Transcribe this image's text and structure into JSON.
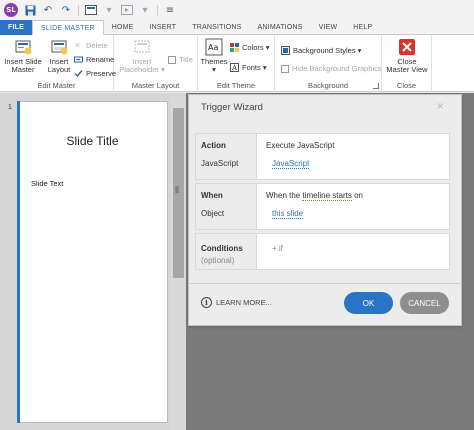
{
  "app": {
    "logo_text": "SL"
  },
  "quick_access": {
    "icons": [
      "save-icon",
      "undo-icon",
      "redo-icon",
      "slide-icon",
      "dropdown-icon",
      "preview-icon",
      "publish-icon",
      "customize-icon"
    ]
  },
  "tabs": [
    {
      "label": "FILE"
    },
    {
      "label": "SLIDE MASTER"
    },
    {
      "label": "HOME"
    },
    {
      "label": "INSERT"
    },
    {
      "label": "TRANSITIONS"
    },
    {
      "label": "ANIMATIONS"
    },
    {
      "label": "VIEW"
    },
    {
      "label": "HELP"
    }
  ],
  "ribbon": {
    "edit_master": {
      "label": "Edit Master",
      "insert_slide_master": "Insert Slide Master",
      "insert_layout": "Insert Layout",
      "delete": "Delete",
      "rename": "Rename",
      "preserve": "Preserve"
    },
    "master_layout": {
      "label": "Master Layout",
      "insert_placeholder": "Insert Placeholder",
      "title": "Title"
    },
    "edit_theme": {
      "label": "Edit Theme",
      "themes": "Themes",
      "colors": "Colors",
      "fonts": "Fonts"
    },
    "background": {
      "label": "Background",
      "background_styles": "Background Styles",
      "hide_background_graphics": "Hide Background Graphics"
    },
    "close": {
      "label": "Close",
      "close_master_view": "Close Master View"
    }
  },
  "thumbnails": {
    "slide_number": "1",
    "slide_title": "Slide Title",
    "slide_text": "Slide Text"
  },
  "dialog": {
    "title": "Trigger Wizard",
    "close": "×",
    "action_label": "Action",
    "action_value": "Execute JavaScript",
    "javascript_label": "JavaScript",
    "javascript_value": "JavaScript",
    "when_label": "When",
    "when_prefix": "When the",
    "when_link": "timeline starts",
    "when_suffix": "on",
    "object_label": "Object",
    "object_value": "this slide",
    "conditions_label": "Conditions",
    "conditions_optional": "(optional)",
    "add_if": "+ if",
    "learn_more": "LEARN MORE...",
    "ok": "OK",
    "cancel": "CANCEL"
  }
}
